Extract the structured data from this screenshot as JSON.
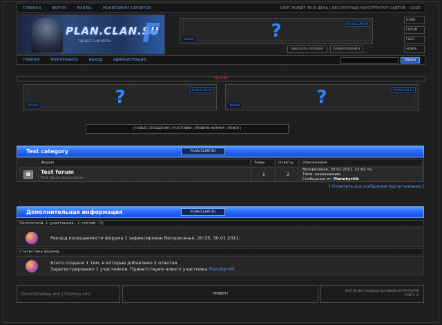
{
  "top_nav": {
    "links": [
      "Главная",
      "Форум",
      "Файлы",
      "Мониторинг серверов"
    ],
    "slogan": "Сайт живет 4Б-й день | Бесплатный конструктор сайтов - uCoz"
  },
  "logo": {
    "title": "PLAN.CLAN.SU",
    "tagline": "THE BEST CLAN PORTAL",
    "mark": "F"
  },
  "ad_top": {
    "tag": "PLAN.CLAN.SU",
    "size": "468x60",
    "question": "?"
  },
  "ad_buttons": [
    "Заказать рекламу",
    "Баннерообмен"
  ],
  "side_nav": [
    "Home",
    "Forum",
    "Files",
    "Admin"
  ],
  "user_nav": {
    "links": [
      "Главная",
      "Мой профиль",
      "Выход",
      "Администрация"
    ]
  },
  "search": {
    "button": "Найти",
    "placeholder": ""
  },
  "ad_label": "Реклама",
  "ads_row": [
    {
      "tag": "PLAN.CLAN.SU",
      "size": "468x60",
      "question": "?"
    },
    {
      "tag": "PLAN.CLAN.SU",
      "size": "468x60",
      "question": "?"
    }
  ],
  "menu_links": "| Новые сообщения | Участники | Правила форума | Поиск |",
  "category": {
    "title": "Test category",
    "badge": "PLAN.CLAN.SU",
    "headers": {
      "forum": "Форум",
      "topics": "Темы",
      "replies": "Ответы",
      "updates": "Обновления"
    },
    "forum": {
      "name": "Test forum",
      "description": "Test forum description",
      "topics": "1",
      "replies": "2",
      "update_line1": "Воскресенье, 30.01.2011, 22:42",
      "update_line2": "Тема: ааааааааааа",
      "update_line3_prefix": "Сообщение от:",
      "update_author": "Planokyr4ik"
    },
    "mark_read": "[ Отметить все сообщения прочитанными ]"
  },
  "info": {
    "title": "Дополнительная информация",
    "badge": "PLAN.CLAN.SU",
    "visitors_label": "Посетители: 1 (участников - 1, гостей - 0)",
    "record_text": "Рекорд посещаемости форума 1 зафиксирован Воскресенье, 20:35, 30.01.2011.",
    "stats_label": "Статистика форума",
    "stats_line1": "Всего создано 1 тем, в которые добавлено 2 ответов.",
    "stats_line2_prefix": "Зарегистрировано 1 участников. Приветствуем нового участника",
    "newest_member": "Planokyr4ik."
  },
  "footer": {
    "links": "ForumSiteMap.xml | SiteMap.xml",
    "center": "Привет!",
    "rights_line1": "Все права защищены администратором",
    "rights_line2": "сайта ©"
  },
  "colors": {
    "accent": "#2a6cff",
    "link": "#5a9cf5",
    "bg": "#1e1e1e"
  }
}
